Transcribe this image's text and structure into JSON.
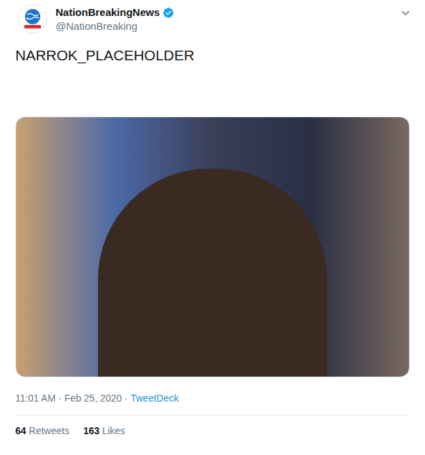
{
  "account": {
    "name": "NationBreakingNews",
    "verified": true,
    "handle": "@NationBreaking"
  },
  "tweet": {
    "text": "NARROK_PLACEHOLDER",
    "time": "11:01 AM",
    "separator": "·",
    "date": "Feb 25, 2020",
    "source": "TweetDeck"
  },
  "stats": [
    {
      "count": "64",
      "label": "Retweets"
    },
    {
      "count": "163",
      "label": "Likes"
    }
  ]
}
